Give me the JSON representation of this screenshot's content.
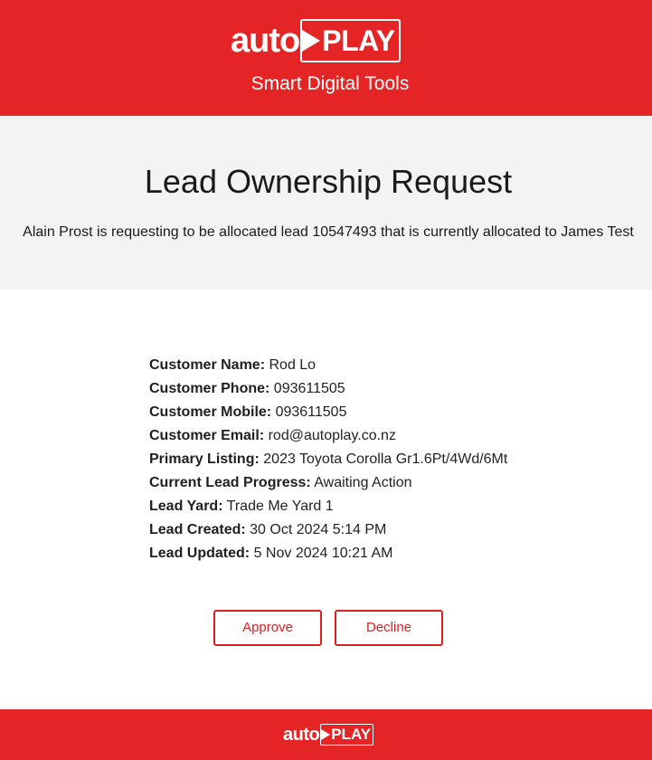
{
  "brand": {
    "logo_left": "auto",
    "logo_right": "PLAY",
    "tagline": "Smart Digital Tools",
    "primary_color": "#e52525"
  },
  "request": {
    "title": "Lead Ownership Request",
    "message": "Alain Prost is requesting to be allocated lead 10547493 that is currently allocated to James Test"
  },
  "details": [
    {
      "label": "Customer Name:",
      "value": "Rod Lo"
    },
    {
      "label": "Customer Phone:",
      "value": "093611505"
    },
    {
      "label": "Customer Mobile:",
      "value": "093611505"
    },
    {
      "label": "Customer Email:",
      "value": "rod@autoplay.co.nz"
    },
    {
      "label": "Primary Listing:",
      "value": "2023 Toyota Corolla Gr1.6Pt/4Wd/6Mt"
    },
    {
      "label": "Current Lead Progress:",
      "value": "Awaiting Action"
    },
    {
      "label": "Lead Yard:",
      "value": "Trade Me Yard 1"
    },
    {
      "label": "Lead Created:",
      "value": "30 Oct 2024 5:14 PM"
    },
    {
      "label": "Lead Updated:",
      "value": "5 Nov 2024 10:21 AM"
    }
  ],
  "actions": {
    "approve_label": "Approve",
    "decline_label": "Decline"
  },
  "icons": {
    "play": "play-icon"
  }
}
